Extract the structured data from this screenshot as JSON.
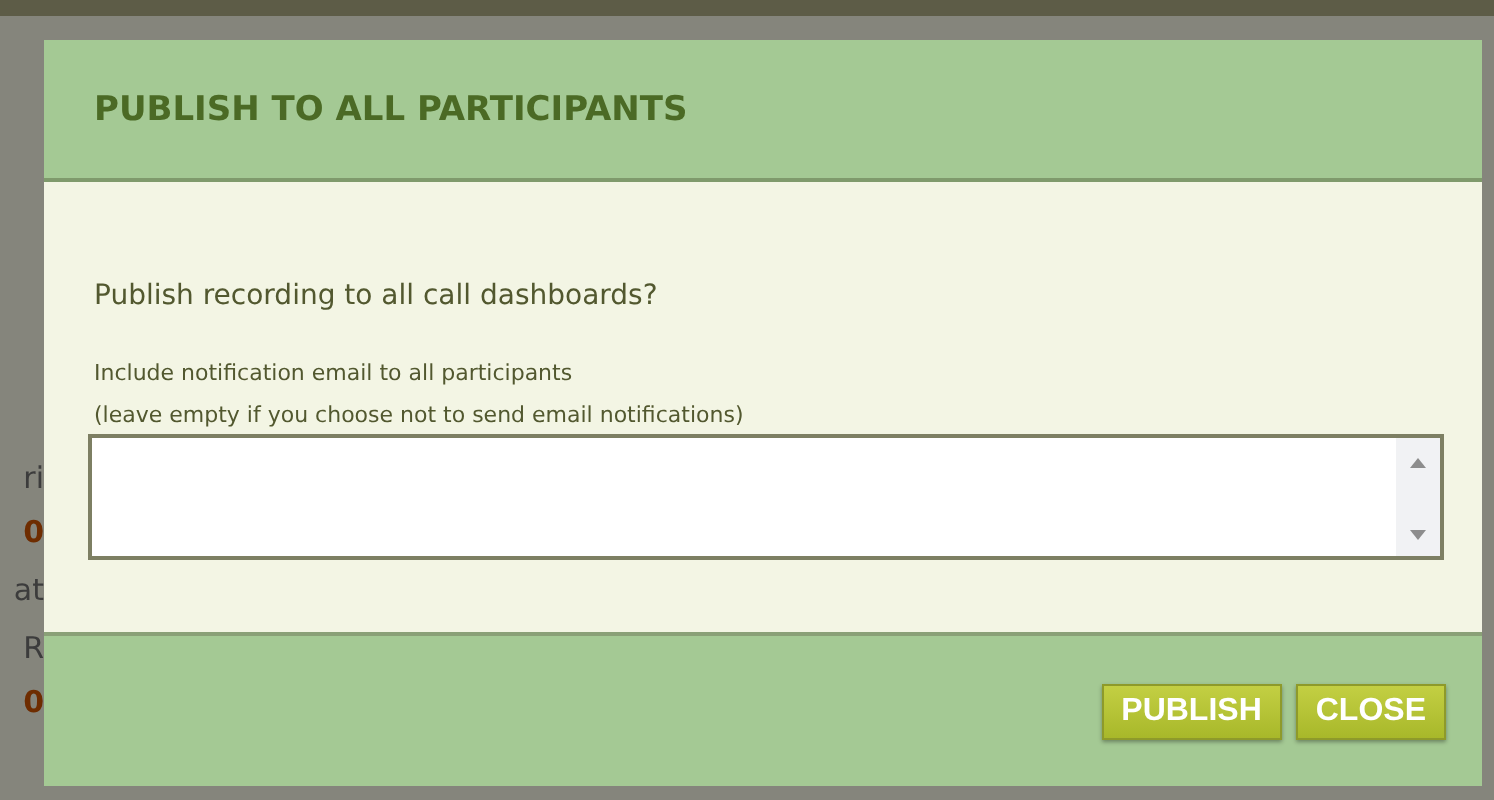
{
  "backdrop": {
    "fragments": [
      {
        "text": "ri",
        "kind": "label"
      },
      {
        "text": "0",
        "kind": "count"
      },
      {
        "text": "at",
        "kind": "label"
      },
      {
        "text": "R",
        "kind": "label"
      },
      {
        "text": "0",
        "kind": "count"
      }
    ]
  },
  "dialog": {
    "title": "PUBLISH TO ALL PARTICIPANTS",
    "question": "Publish recording to all call dashboards?",
    "field_label": "Include notification email to all participants",
    "field_hint": "(leave empty if you choose not to send email notifications)",
    "buttons": [
      "PUBLISH",
      "CLOSE"
    ]
  }
}
